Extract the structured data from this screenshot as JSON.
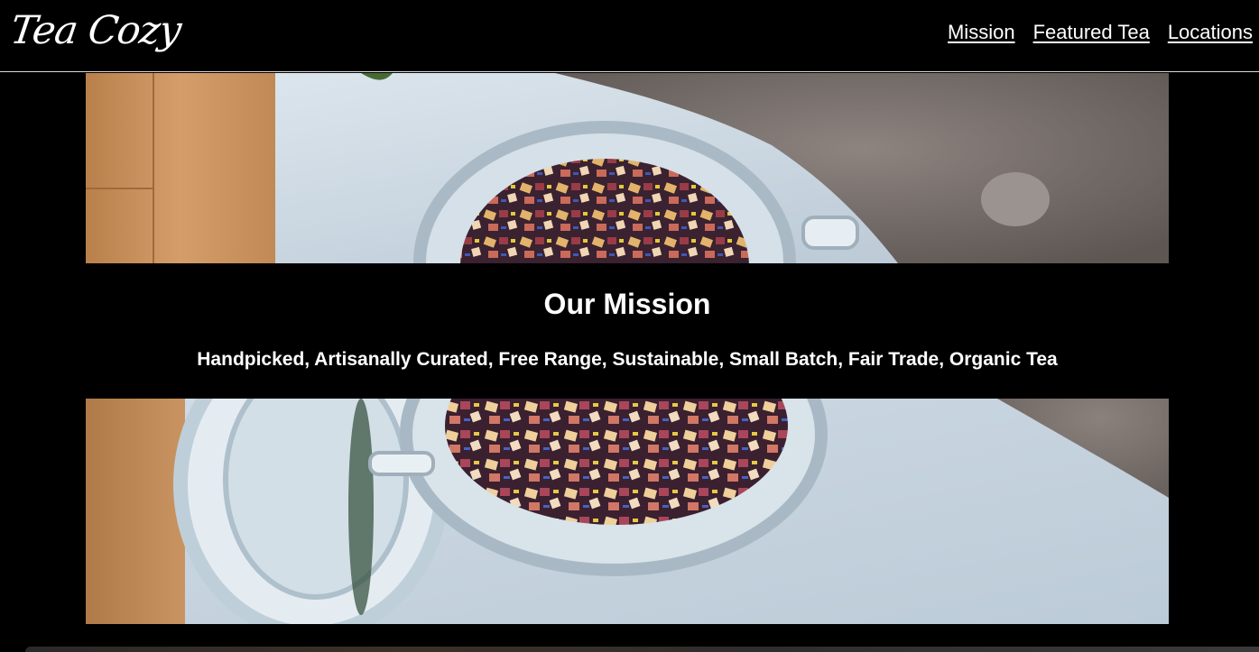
{
  "header": {
    "logo_text": "Tea Cozy",
    "nav": [
      {
        "label": "Mission"
      },
      {
        "label": "Featured Tea"
      },
      {
        "label": "Locations"
      }
    ]
  },
  "mission": {
    "title": "Our Mission",
    "subtitle": "Handpicked, Artisanally Curated, Free Range, Sustainable, Small Batch, Fair Trade, Organic Tea"
  },
  "colors": {
    "background": "#000000",
    "text": "#ffffff"
  }
}
